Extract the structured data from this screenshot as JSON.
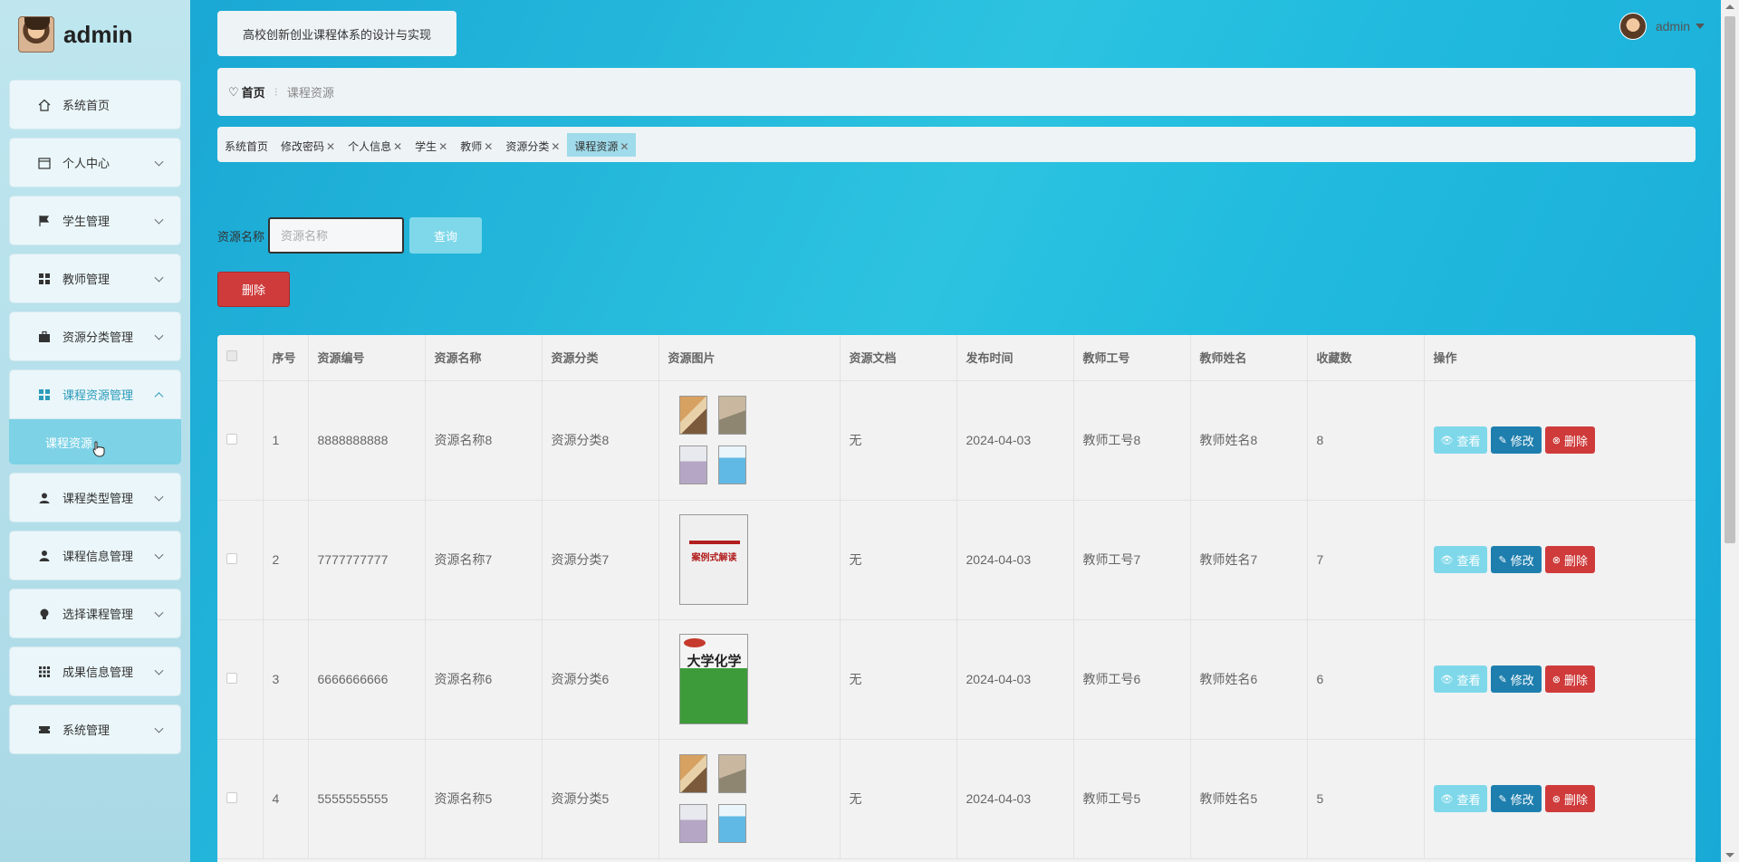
{
  "sidebar": {
    "brand": "admin",
    "items": [
      {
        "label": "系统首页",
        "icon": "home-icon"
      },
      {
        "label": "个人中心",
        "icon": "calendar-icon"
      },
      {
        "label": "学生管理",
        "icon": "flag-icon"
      },
      {
        "label": "教师管理",
        "icon": "grid-icon"
      },
      {
        "label": "资源分类管理",
        "icon": "briefcase-icon"
      },
      {
        "label": "课程资源管理",
        "icon": "grid-icon"
      },
      {
        "label": "课程类型管理",
        "icon": "user-icon"
      },
      {
        "label": "课程信息管理",
        "icon": "user-icon"
      },
      {
        "label": "选择课程管理",
        "icon": "bulb-icon"
      },
      {
        "label": "成果信息管理",
        "icon": "apps-icon"
      },
      {
        "label": "系统管理",
        "icon": "ticket-icon"
      }
    ],
    "submenu_label": "课程资源"
  },
  "header": {
    "title": "高校创新创业课程体系的设计与实现",
    "user": "admin"
  },
  "breadcrumb": {
    "home": "首页",
    "current": "课程资源"
  },
  "tags": [
    "系统首页",
    "修改密码",
    "个人信息",
    "学生",
    "教师",
    "资源分类",
    "课程资源"
  ],
  "search": {
    "label": "资源名称",
    "placeholder": "资源名称",
    "query_label": "查询",
    "delete_label": "删除"
  },
  "table": {
    "headers": [
      "序号",
      "资源编号",
      "资源名称",
      "资源分类",
      "资源图片",
      "资源文档",
      "发布时间",
      "教师工号",
      "教师姓名",
      "收藏数",
      "操作"
    ],
    "rows": [
      {
        "no": "1",
        "code": "8888888888",
        "name": "资源名称8",
        "category": "资源分类8",
        "image": "books-grid",
        "doc": "无",
        "time": "2024-04-03",
        "tid": "教师工号8",
        "tname": "教师姓名8",
        "fav": "8"
      },
      {
        "no": "2",
        "code": "7777777777",
        "name": "资源名称7",
        "category": "资源分类7",
        "image": "case-cover",
        "doc": "无",
        "time": "2024-04-03",
        "tid": "教师工号7",
        "tname": "教师姓名7",
        "fav": "7"
      },
      {
        "no": "3",
        "code": "6666666666",
        "name": "资源名称6",
        "category": "资源分类6",
        "image": "chem-cover",
        "doc": "无",
        "time": "2024-04-03",
        "tid": "教师工号6",
        "tname": "教师姓名6",
        "fav": "6"
      },
      {
        "no": "4",
        "code": "5555555555",
        "name": "资源名称5",
        "category": "资源分类5",
        "image": "books-grid",
        "doc": "无",
        "time": "2024-04-03",
        "tid": "教师工号5",
        "tname": "教师姓名5",
        "fav": "5"
      }
    ],
    "actions": {
      "view": "查看",
      "edit": "修改",
      "delete": "删除"
    },
    "cover_text": {
      "case": "案例式解读",
      "chem": "大学化学"
    }
  }
}
